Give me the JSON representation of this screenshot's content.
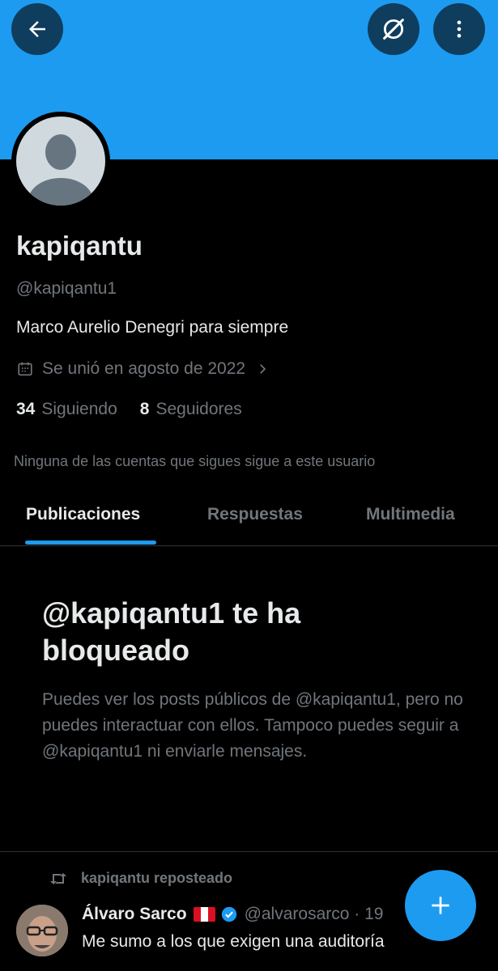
{
  "header": {
    "back_icon": "arrow-left-icon",
    "grok_icon": "grok-icon",
    "more_icon": "more-vertical-icon",
    "banner_color": "#1d9bf0"
  },
  "profile": {
    "display_name": "kapiqantu",
    "handle": "@kapiqantu1",
    "bio": "Marco Aurelio Denegri para siempre",
    "joined": "Se unió en agosto de 2022",
    "following_count": "34",
    "following_label": "Siguiendo",
    "followers_count": "8",
    "followers_label": "Seguidores",
    "mutual_note": "Ninguna de las cuentas que sigues sigue a este usuario"
  },
  "tabs": [
    {
      "label": "Publicaciones",
      "active": true
    },
    {
      "label": "Respuestas",
      "active": false
    },
    {
      "label": "Multimedia",
      "active": false
    }
  ],
  "blocked": {
    "title": "@kapiqantu1 te ha bloqueado",
    "message": "Puedes ver los posts públicos de @kapiqantu1, pero no puedes interactuar con ellos. Tampoco puedes seguir a @kapiqantu1 ni enviarle mensajes."
  },
  "feed": {
    "repost_label": "kapiqantu reposteado",
    "tweet": {
      "author": "Álvaro Sarco",
      "handle": "@alvarosarco · 19",
      "text": "Me sumo a los que exigen una auditoría"
    }
  },
  "fab": {
    "icon": "plus-icon"
  },
  "colors": {
    "accent": "#1d9bf0",
    "muted": "#71767b",
    "text": "#e7e9ea",
    "background": "#000000"
  }
}
